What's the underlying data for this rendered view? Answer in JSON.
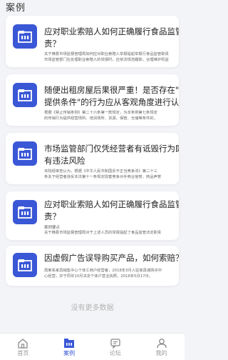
{
  "header": {
    "title": "案例"
  },
  "cards": [
    {
      "title_lines": [
        "应对职业索赔人如何正确履行食品监管职",
        "责？"
      ],
      "desc_lines": [
        "关于横县市场监督管理局如何应对职业索赔人举报提起举报行食品监管职责",
        "市场监管部门在处理职业索赔人的举报时，应依法规范履职，合理维护权益"
      ],
      "label": ""
    },
    {
      "title_lines": [
        "随便出租房屋后果很严重！是否存在\"为",
        "提供条件\"的行为应从客观角度进行认定"
      ],
      "desc_lines": [
        "根据《禁止传销条例》第二十六条第一款规定，为本条例第七条规定",
        "的传销行为提供经营场所、培训场所、货源、保管、仓储等条件的，"
      ],
      "label": ""
    },
    {
      "title_lines": [
        "市场监管部门仅凭经营者有诋毁行为即认定",
        "有违法风险"
      ],
      "desc_lines": [
        "本院经审查认为，根据《中华人民共和国反不正当竞争法》第二十三",
        "条关于经营者违反本法第十一条规定损害竞争对手商业信誉、商品声誉"
      ],
      "label": ""
    },
    {
      "title_lines": [
        "应对职业索赔人如何正确履行食品监管职",
        "责？"
      ],
      "desc_lines": [],
      "label": "案例要点",
      "label_desc": "关于横县市场监督管理局对于上述人员的举报提起了食品监管法定职责"
    },
    {
      "title_lines": [
        "因虚假广告误导购买产品，如何索赔？"
      ],
      "desc_lines": [
        "周某系家具销售中心个体工商户经营者，2018年3月入驻家具城购买中",
        "心经营，并于同年10月决定个体户营业执照，2018年5月17日。"
      ],
      "label": ""
    }
  ],
  "footer": {
    "no_more": "没有更多数据"
  },
  "tabs": [
    {
      "label": "首页",
      "icon": "home-icon",
      "active": false
    },
    {
      "label": "案例",
      "icon": "case-icon",
      "active": true
    },
    {
      "label": "论坛",
      "icon": "forum-icon",
      "active": false
    },
    {
      "label": "我的",
      "icon": "user-icon",
      "active": false
    }
  ],
  "colors": {
    "accent": "#3a57d6",
    "background": "#f3f4f7",
    "muted": "#999999"
  }
}
